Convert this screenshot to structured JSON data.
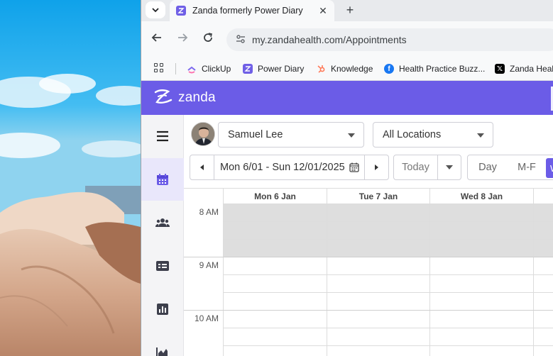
{
  "browser": {
    "tab": {
      "title": "Zanda formerly Power Diary",
      "close": "✕"
    },
    "new_tab": "+",
    "url": "my.zandahealth.com/Appointments",
    "bookmarks": [
      {
        "label": "ClickUp",
        "icon": "clickup-icon"
      },
      {
        "label": "Power Diary",
        "icon": "zanda-icon"
      },
      {
        "label": "Knowledge",
        "icon": "hubspot-icon"
      },
      {
        "label": "Health Practice Buzz...",
        "icon": "facebook-icon"
      },
      {
        "label": "Zanda Healt",
        "icon": "x-icon"
      }
    ]
  },
  "app": {
    "brand": "zanda",
    "brand_color": "#6b5ce7",
    "sidebar": [
      {
        "name": "menu",
        "icon": "hamburger-menu-icon",
        "active": false
      },
      {
        "name": "calendar",
        "icon": "calendar-icon",
        "active": true
      },
      {
        "name": "clients",
        "icon": "users-icon",
        "active": false
      },
      {
        "name": "invoices",
        "icon": "id-card-icon",
        "active": false
      },
      {
        "name": "reports",
        "icon": "bar-chart-icon",
        "active": false
      },
      {
        "name": "analytics",
        "icon": "area-chart-icon",
        "active": false
      }
    ],
    "practitioner": "Samuel Lee",
    "location": "All Locations",
    "date_range": "Mon 6/01 - Sun 12/01/2025",
    "today_label": "Today",
    "views": {
      "day": "Day",
      "mf": "M-F",
      "week": "W"
    },
    "calendar": {
      "days": [
        "Mon 6 Jan",
        "Tue 7 Jan",
        "Wed 8 Jan"
      ],
      "times": [
        "8 AM",
        "9 AM",
        "10 AM"
      ]
    }
  }
}
